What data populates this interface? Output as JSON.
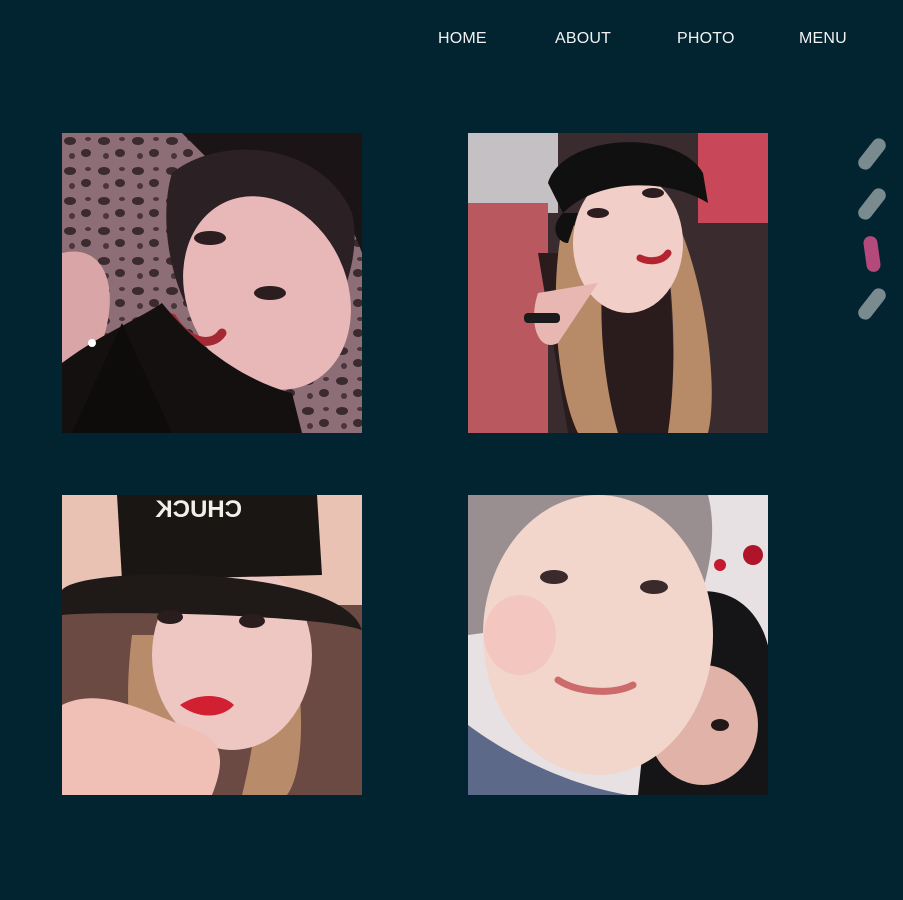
{
  "nav": {
    "items": [
      {
        "label": "HOME"
      },
      {
        "label": "ABOUT"
      },
      {
        "label": "PHOTO"
      },
      {
        "label": "MENU"
      }
    ]
  },
  "gallery": {
    "photos": [
      {
        "subject": "selfie-leopard-print-background"
      },
      {
        "subject": "selfie-black-cap"
      },
      {
        "subject": "selfie-chuck-bucket-hat"
      },
      {
        "subject": "two-person-selfie"
      }
    ]
  },
  "pager": {
    "total": 4,
    "active_index": 2,
    "active_color": "#b4497c",
    "inactive_color": "#7a8b8f"
  },
  "colors": {
    "background": "#022330",
    "nav_text": "#f2f2f2"
  },
  "photo_text": {
    "hat_text": "CHUCK"
  }
}
